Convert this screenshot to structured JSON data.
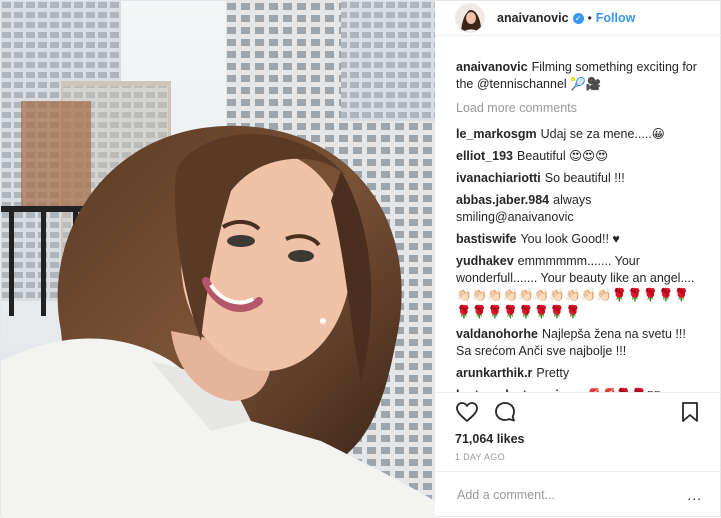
{
  "header": {
    "username": "anaivanovic",
    "verified_icon": "verified-check-icon",
    "separator": "•",
    "follow_label": "Follow"
  },
  "caption": {
    "username": "anaivanovic",
    "text": "Filming something exciting for the @tennischannel 🎾🎥"
  },
  "load_more_label": "Load more comments",
  "comments": [
    {
      "user": "le_markosgm",
      "text": "Udaj se za mene.....😀"
    },
    {
      "user": "elliot_193",
      "text": "Beautiful 😍😍😍"
    },
    {
      "user": "ivanachiariotti",
      "text": "So beautiful !!!"
    },
    {
      "user": "abbas.jaber.984",
      "text": "always smiling@anaivanovic"
    },
    {
      "user": "bastiswife",
      "text": "You look Good!! ♥"
    },
    {
      "user": "yudhakev",
      "text": "emmmmmm....... Your wonderfull....... Your beauty like an angel.... 👏🏻👏🏻👏🏻👏🏻👏🏻👏🏻👏🏻👏🏻👏🏻👏🏻🌹🌹🌹🌹🌹🌹🌹🌹🌹🌹🌹🌹🌹"
    },
    {
      "user": "valdanohorhe",
      "text": "Najlepša žena na svetu !!! Sa srećom Anči sve najbolje !!!"
    },
    {
      "user": "arunkarthik.r",
      "text": "Pretty"
    },
    {
      "user": "krstonadastevovic",
      "text": "♥♥💋💋🌹🌹▯▯"
    }
  ],
  "actions": {
    "like_icon": "heart-icon",
    "comment_icon": "comment-bubble-icon",
    "save_icon": "bookmark-icon"
  },
  "likes": "71,064 likes",
  "timestamp": "1 DAY AGO",
  "add_comment_placeholder": "Add a comment...",
  "more_label": "..."
}
